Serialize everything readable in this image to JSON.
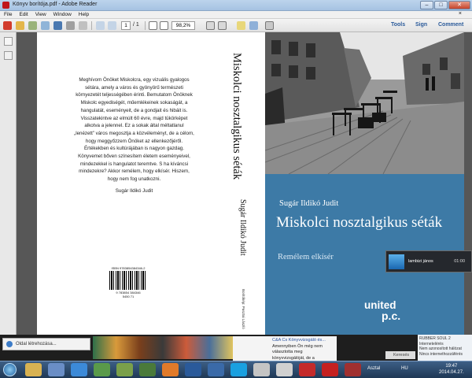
{
  "window": {
    "title": "Könyv borítója.pdf - Adobe Reader",
    "minimize": "–",
    "maximize": "□",
    "close": "✕"
  },
  "menu": {
    "items": [
      "File",
      "Edit",
      "View",
      "Window",
      "Help"
    ],
    "close_glyph": "×"
  },
  "toolbar": {
    "page_current": "1",
    "page_total": "/ 1",
    "zoom": "98,2%",
    "tools_label": "Tools",
    "sign_label": "Sign",
    "comment_label": "Comment"
  },
  "book": {
    "blurb_paragraphs": [
      "Meghívom Önöket Miskolcra, egy vizuális gyalogos sétára, amely a város és gyönyörű természeti környezetét teljességében érinti. Bemutatom Önöknek Miskolc egyediségét, műemlékeinek sokaságát, a hangulatát, eseményeit, de a gondjait és hibáit is. Visszatekintve az elmúlt 60 évre, majd tükörképet alkotva a jelennel. Ez a sokak által méltatlanul „lenézett” város megosztja a közvéleményt, de a célom, hogy meggyőzzem Önöket az ellenkezőjéről. Értékekben és kultúrájában is nagyon gazdag. Könyvemet bőven színesítem életem eseményeivel, mindezekkel is hangulatot teremtve. S ha kíváncsi mindezekre? Akkor remélem, hogy elkísér. Hiszem, hogy nem fog unatkozni.",
      "Sugár Ildikó Judit"
    ],
    "isbn": "ISBN 9783854384346-2",
    "barcode_number": "9 783854 384346",
    "barcode_suffix": "5450 71",
    "spine_title": "Miskolci nosztalgikus séták",
    "spine_author": "Sugár Ildikó Judit",
    "spine_publisher": "Borítókép: Pusztai László",
    "front_author": "Sugár Ildikó Judit",
    "front_title": "Miskolci nosztalgikus séták",
    "front_subtitle": "Remélem elkísér",
    "publisher_name": "united",
    "publisher_sub": "p.c.",
    "cover_blue": "#3d7aa6"
  },
  "notification": {
    "name": "lambizi jános",
    "time": "01:00"
  },
  "browser_strip": {
    "tab_label": "Oldal létrehozása...",
    "chat_lines": [
      "C&A Cs Könyvvizsgáló és...",
      "Amennyiben Ön még nem választotta meg",
      "könyvvizsgálóját, de a jogszabály alapján ilyen"
    ],
    "search_label": "Keresés",
    "right_info": [
      "RUBBER SOUL 2",
      "Internetelérés",
      "Nem azonosított hálózat",
      "Nincs internethozzáférés"
    ]
  },
  "taskbar": {
    "desktop_label": "Asztal",
    "language": "HU",
    "time": "19:47",
    "date": "2014.04.27."
  }
}
